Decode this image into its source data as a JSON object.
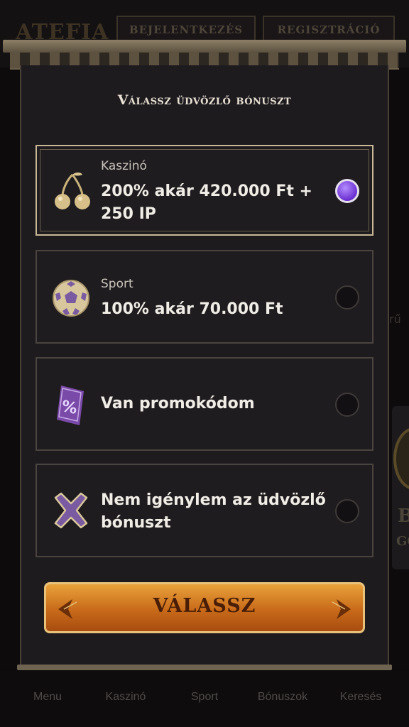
{
  "background": {
    "logo": "ATEFIA",
    "login_button": "BEJELENTKEZÉS",
    "register_button": "REGISZTRÁCIÓ",
    "partial_text": "rű",
    "banner_partial_1": "B",
    "banner_partial_2": "GO",
    "bottom_nav": [
      "Menu",
      "Kaszinó",
      "Sport",
      "Bónuszok",
      "Keresés"
    ]
  },
  "modal": {
    "title": "Válassz üdvözlő bónuszt",
    "options": [
      {
        "label": "Kaszinó",
        "value": "200% akár 420.000 Ft + 250 IP",
        "icon": "cherries-icon",
        "selected": true
      },
      {
        "label": "Sport",
        "value": "100% akár 70.000 Ft",
        "icon": "soccer-ball-icon",
        "selected": false
      },
      {
        "label": "",
        "value": "Van promokódom",
        "icon": "promo-ticket-icon",
        "selected": false
      },
      {
        "label": "",
        "value": "Nem igénylem az üdvözlő bónuszt",
        "icon": "close-x-icon",
        "selected": false
      }
    ],
    "submit_button": "VÁLASSZ"
  },
  "colors": {
    "accent_selected": "#7c3cff",
    "button_orange": "#d97a22",
    "gold_border": "#c8b896"
  }
}
